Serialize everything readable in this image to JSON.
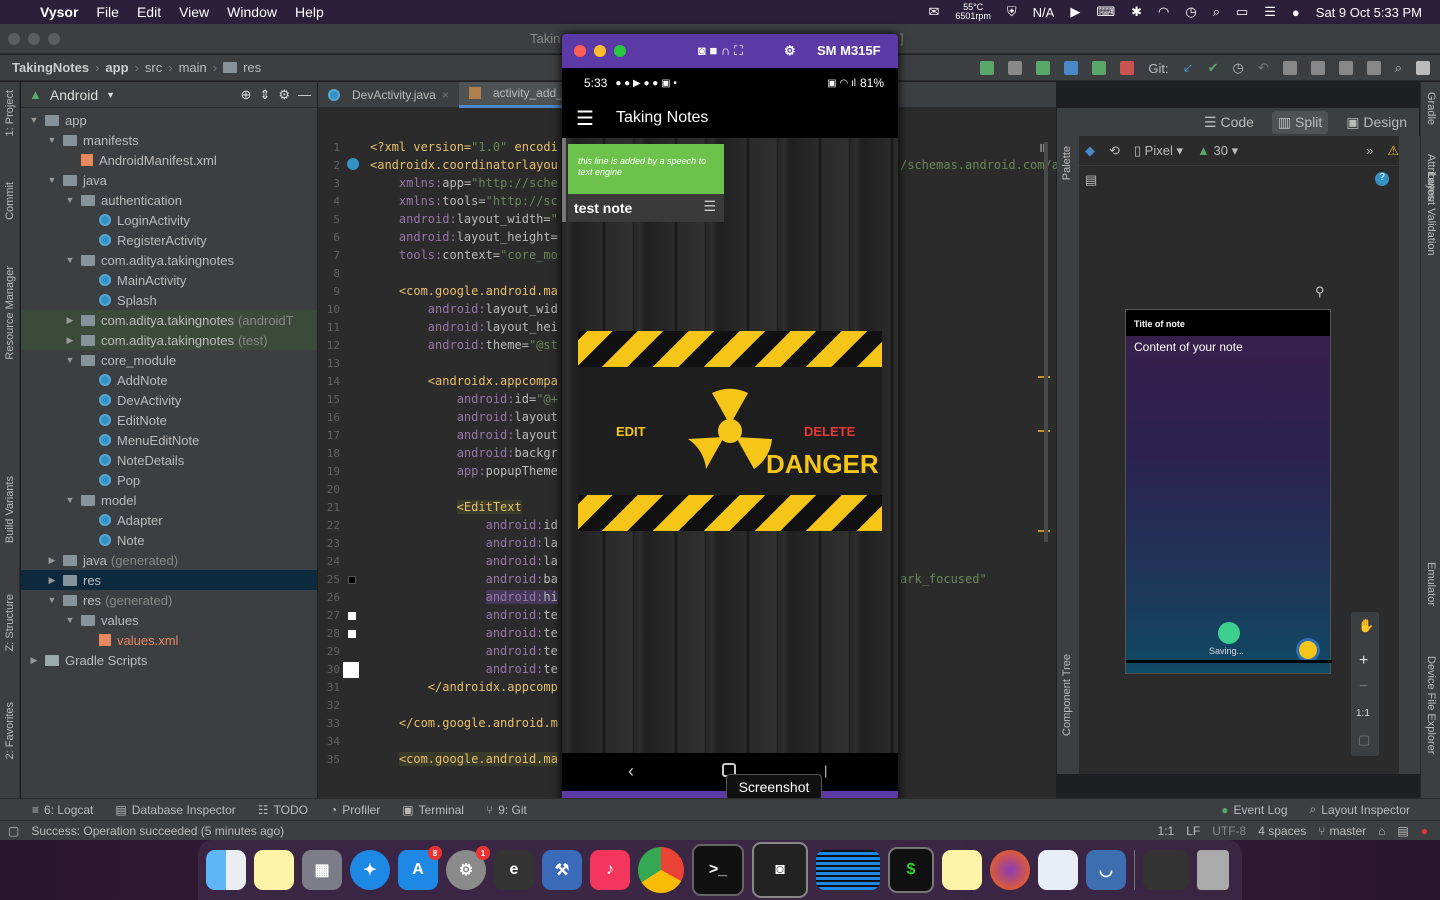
{
  "menubar": {
    "app_name": "Vysor",
    "items": [
      "File",
      "Edit",
      "View",
      "Window",
      "Help"
    ],
    "temp": "55°C",
    "rpm": "6501rpm",
    "na": "N/A",
    "datetime": "Sat 9 Oct  5:33 PM"
  },
  "window": {
    "title": "Takin"
  },
  "breadcrumb": [
    "TakingNotes",
    "app",
    "src",
    "main",
    "res"
  ],
  "toolbar": {
    "git_label": "Git:"
  },
  "left_strip": {
    "project": "1: Project",
    "commit": "Commit",
    "resource": "Resource Manager",
    "build": "Build Variants",
    "structure": "Z: Structure",
    "favorites": "2: Favorites"
  },
  "project_panel": {
    "view_name": "Android",
    "tree": [
      {
        "label": "app",
        "indent": 0,
        "arrow": "▼",
        "icon": "folder"
      },
      {
        "label": "manifests",
        "indent": 1,
        "arrow": "▼",
        "icon": "folder"
      },
      {
        "label": "AndroidManifest.xml",
        "indent": 2,
        "arrow": "",
        "icon": "xml"
      },
      {
        "label": "java",
        "indent": 1,
        "arrow": "▼",
        "icon": "folder"
      },
      {
        "label": "authentication",
        "indent": 2,
        "arrow": "▼",
        "icon": "folder"
      },
      {
        "label": "LoginActivity",
        "indent": 3,
        "arrow": "",
        "icon": "class"
      },
      {
        "label": "RegisterActivity",
        "indent": 3,
        "arrow": "",
        "icon": "class"
      },
      {
        "label": "com.aditya.takingnotes",
        "indent": 2,
        "arrow": "▼",
        "icon": "folder"
      },
      {
        "label": "MainActivity",
        "indent": 3,
        "arrow": "",
        "icon": "class"
      },
      {
        "label": "Splash",
        "indent": 3,
        "arrow": "",
        "icon": "class"
      },
      {
        "label": "com.aditya.takingnotes",
        "suffix": "(androidT",
        "indent": 2,
        "arrow": "▶",
        "icon": "folder",
        "hl": true
      },
      {
        "label": "com.aditya.takingnotes",
        "suffix": "(test)",
        "indent": 2,
        "arrow": "▶",
        "icon": "folder",
        "hl": true
      },
      {
        "label": "core_module",
        "indent": 2,
        "arrow": "▼",
        "icon": "folder"
      },
      {
        "label": "AddNote",
        "indent": 3,
        "arrow": "",
        "icon": "class"
      },
      {
        "label": "DevActivity",
        "indent": 3,
        "arrow": "",
        "icon": "class"
      },
      {
        "label": "EditNote",
        "indent": 3,
        "arrow": "",
        "icon": "class"
      },
      {
        "label": "MenuEditNote",
        "indent": 3,
        "arrow": "",
        "icon": "class"
      },
      {
        "label": "NoteDetails",
        "indent": 3,
        "arrow": "",
        "icon": "class"
      },
      {
        "label": "Pop",
        "indent": 3,
        "arrow": "",
        "icon": "class"
      },
      {
        "label": "model",
        "indent": 2,
        "arrow": "▼",
        "icon": "folder"
      },
      {
        "label": "Adapter",
        "indent": 3,
        "arrow": "",
        "icon": "class"
      },
      {
        "label": "Note",
        "indent": 3,
        "arrow": "",
        "icon": "class"
      },
      {
        "label": "java",
        "suffix": "(generated)",
        "indent": 1,
        "arrow": "▶",
        "icon": "folder"
      },
      {
        "label": "res",
        "indent": 1,
        "arrow": "▶",
        "icon": "folder",
        "sel": true
      },
      {
        "label": "res",
        "suffix": "(generated)",
        "indent": 1,
        "arrow": "▼",
        "icon": "folder"
      },
      {
        "label": "values",
        "indent": 2,
        "arrow": "▼",
        "icon": "folder"
      },
      {
        "label": "values.xml",
        "indent": 3,
        "arrow": "",
        "icon": "xml",
        "orange": true
      },
      {
        "label": "Gradle Scripts",
        "indent": 0,
        "arrow": "▶",
        "icon": "gradle"
      }
    ]
  },
  "editor": {
    "tabs": [
      {
        "label": "DevActivity.java",
        "active": false
      },
      {
        "label": "activity_add_",
        "active": true
      }
    ],
    "lines": [
      {
        "n": "1",
        "html": "<span class='ct'>&lt;?xml version=</span><span class='cv'>\"1.0\"</span><span class='ct'> encodi</span>"
      },
      {
        "n": "2",
        "html": "<span class='ct'>&lt;androidx.coordinatorlayou</span>"
      },
      {
        "n": "3",
        "html": "&nbsp;&nbsp;&nbsp;&nbsp;<span class='cp'>xmlns:</span><span class='ca'>app=</span><span class='cv'>\"http://sche</span>"
      },
      {
        "n": "4",
        "html": "&nbsp;&nbsp;&nbsp;&nbsp;<span class='cp'>xmlns:</span><span class='ca'>tools=</span><span class='cv'>\"http://sc</span>"
      },
      {
        "n": "5",
        "html": "&nbsp;&nbsp;&nbsp;&nbsp;<span class='cp'>android:</span><span class='ca'>layout_width=</span><span class='cv'>\"</span>"
      },
      {
        "n": "6",
        "html": "&nbsp;&nbsp;&nbsp;&nbsp;<span class='cp'>android:</span><span class='ca'>layout_height=</span>"
      },
      {
        "n": "7",
        "html": "&nbsp;&nbsp;&nbsp;&nbsp;<span class='cp'>tools:</span><span class='ca'>context=</span><span class='cv'>\"core_mo</span>"
      },
      {
        "n": "8",
        "html": ""
      },
      {
        "n": "9",
        "html": "&nbsp;&nbsp;&nbsp;&nbsp;<span class='ct'>&lt;com.google.android.ma</span>"
      },
      {
        "n": "10",
        "html": "&nbsp;&nbsp;&nbsp;&nbsp;&nbsp;&nbsp;&nbsp;&nbsp;<span class='cp'>android:</span><span class='ca'>layout_wid</span>"
      },
      {
        "n": "11",
        "html": "&nbsp;&nbsp;&nbsp;&nbsp;&nbsp;&nbsp;&nbsp;&nbsp;<span class='cp'>android:</span><span class='ca'>layout_hei</span>"
      },
      {
        "n": "12",
        "html": "&nbsp;&nbsp;&nbsp;&nbsp;&nbsp;&nbsp;&nbsp;&nbsp;<span class='cp'>android:</span><span class='ca'>theme=</span><span class='cv'>\"@st</span>"
      },
      {
        "n": "13",
        "html": ""
      },
      {
        "n": "14",
        "html": "&nbsp;&nbsp;&nbsp;&nbsp;&nbsp;&nbsp;&nbsp;&nbsp;<span class='ct'>&lt;androidx.appcompa</span>"
      },
      {
        "n": "15",
        "html": "&nbsp;&nbsp;&nbsp;&nbsp;&nbsp;&nbsp;&nbsp;&nbsp;&nbsp;&nbsp;&nbsp;&nbsp;<span class='cp'>android:</span><span class='ca'>id=</span><span class='cv'>\"@+</span>"
      },
      {
        "n": "16",
        "html": "&nbsp;&nbsp;&nbsp;&nbsp;&nbsp;&nbsp;&nbsp;&nbsp;&nbsp;&nbsp;&nbsp;&nbsp;<span class='cp'>android:</span><span class='ca'>layout</span>"
      },
      {
        "n": "17",
        "html": "&nbsp;&nbsp;&nbsp;&nbsp;&nbsp;&nbsp;&nbsp;&nbsp;&nbsp;&nbsp;&nbsp;&nbsp;<span class='cp'>android:</span><span class='ca'>layout</span>"
      },
      {
        "n": "18",
        "html": "&nbsp;&nbsp;&nbsp;&nbsp;&nbsp;&nbsp;&nbsp;&nbsp;&nbsp;&nbsp;&nbsp;&nbsp;<span class='cp'>android:</span><span class='ca'>backgr</span>"
      },
      {
        "n": "19",
        "html": "&nbsp;&nbsp;&nbsp;&nbsp;&nbsp;&nbsp;&nbsp;&nbsp;&nbsp;&nbsp;&nbsp;&nbsp;<span class='cp'>app:</span><span class='ca'>popupTheme</span>"
      },
      {
        "n": "20",
        "html": ""
      },
      {
        "n": "21",
        "html": "&nbsp;&nbsp;&nbsp;&nbsp;&nbsp;&nbsp;&nbsp;&nbsp;&nbsp;&nbsp;&nbsp;&nbsp;<span class='ct' style='background:#3b3b2a'>&lt;EditText</span>"
      },
      {
        "n": "22",
        "html": "&nbsp;&nbsp;&nbsp;&nbsp;&nbsp;&nbsp;&nbsp;&nbsp;&nbsp;&nbsp;&nbsp;&nbsp;&nbsp;&nbsp;&nbsp;&nbsp;<span class='cp'>android:</span><span class='ca'>id</span>"
      },
      {
        "n": "23",
        "html": "&nbsp;&nbsp;&nbsp;&nbsp;&nbsp;&nbsp;&nbsp;&nbsp;&nbsp;&nbsp;&nbsp;&nbsp;&nbsp;&nbsp;&nbsp;&nbsp;<span class='cp'>android:</span><span class='ca'>la</span>"
      },
      {
        "n": "24",
        "html": "&nbsp;&nbsp;&nbsp;&nbsp;&nbsp;&nbsp;&nbsp;&nbsp;&nbsp;&nbsp;&nbsp;&nbsp;&nbsp;&nbsp;&nbsp;&nbsp;<span class='cp'>android:</span><span class='ca'>la</span>"
      },
      {
        "n": "25",
        "html": "&nbsp;&nbsp;&nbsp;&nbsp;&nbsp;&nbsp;&nbsp;&nbsp;&nbsp;&nbsp;&nbsp;&nbsp;&nbsp;&nbsp;&nbsp;&nbsp;<span class='cp'>android:</span><span class='ca'>ba</span>"
      },
      {
        "n": "26",
        "html": "&nbsp;&nbsp;&nbsp;&nbsp;&nbsp;&nbsp;&nbsp;&nbsp;&nbsp;&nbsp;&nbsp;&nbsp;&nbsp;&nbsp;&nbsp;&nbsp;<span class='cp' style='background:#44395a'>android:</span><span class='ca' style='background:#44395a'>hi</span>"
      },
      {
        "n": "27",
        "html": "&nbsp;&nbsp;&nbsp;&nbsp;&nbsp;&nbsp;&nbsp;&nbsp;&nbsp;&nbsp;&nbsp;&nbsp;&nbsp;&nbsp;&nbsp;&nbsp;<span class='cp'>android:</span><span class='ca'>te</span>"
      },
      {
        "n": "28",
        "html": "&nbsp;&nbsp;&nbsp;&nbsp;&nbsp;&nbsp;&nbsp;&nbsp;&nbsp;&nbsp;&nbsp;&nbsp;&nbsp;&nbsp;&nbsp;&nbsp;<span class='cp'>android:</span><span class='ca'>te</span>"
      },
      {
        "n": "29",
        "html": "&nbsp;&nbsp;&nbsp;&nbsp;&nbsp;&nbsp;&nbsp;&nbsp;&nbsp;&nbsp;&nbsp;&nbsp;&nbsp;&nbsp;&nbsp;&nbsp;<span class='cp'>android:</span><span class='ca'>te</span>"
      },
      {
        "n": "30",
        "html": "&nbsp;&nbsp;&nbsp;&nbsp;&nbsp;&nbsp;&nbsp;&nbsp;&nbsp;&nbsp;&nbsp;&nbsp;&nbsp;&nbsp;&nbsp;&nbsp;<span class='cp'>android:</span><span class='ca'>te</span>"
      },
      {
        "n": "31",
        "html": "&nbsp;&nbsp;&nbsp;&nbsp;&nbsp;&nbsp;&nbsp;&nbsp;<span class='ct'>&lt;/androidx.appcomp</span>"
      },
      {
        "n": "32",
        "html": ""
      },
      {
        "n": "33",
        "html": "&nbsp;&nbsp;&nbsp;&nbsp;<span class='ct'>&lt;/com.google.android.m</span>"
      },
      {
        "n": "34",
        "html": ""
      },
      {
        "n": "35",
        "html": "&nbsp;&nbsp;&nbsp;&nbsp;<span class='ct' style='background:#3b3b2a'>&lt;com.google.android.ma</span>"
      }
    ],
    "overflow_text_1": "/schemas.android.com/a",
    "overflow_text_2": "ark_focused\""
  },
  "phone": {
    "device_name": "SM M315F",
    "time": "5:33",
    "battery": "81%",
    "app_title": "Taking Notes",
    "note_speech": "this line is added by a speech to text engine",
    "note_title": "test note",
    "danger_edit": "EDIT",
    "danger_delete": "DELETE",
    "danger_word": "DANGER",
    "tooltip": "Screenshot"
  },
  "design": {
    "modes": [
      "Code",
      "Split",
      "Design"
    ],
    "device": "Pixel",
    "api": "30",
    "palette": "Palette",
    "component_tree": "Component Tree",
    "preview_title": "Title of note",
    "preview_content": "Content of your note",
    "preview_saving": "Saving...",
    "zoom_label": "1:1"
  },
  "right_strip": {
    "gradle": "Gradle",
    "attributes": "Attributes",
    "layout_validation": "Layout Validation",
    "emulator": "Emulator",
    "device_file_explorer": "Device File Explorer"
  },
  "bottom_tools": [
    {
      "label": "6: Logcat"
    },
    {
      "label": "Database Inspector"
    },
    {
      "label": "TODO"
    },
    {
      "label": "Profiler"
    },
    {
      "label": "Terminal"
    },
    {
      "label": "9: Git"
    }
  ],
  "bottom_right_tools": [
    {
      "label": "Event Log"
    },
    {
      "label": "Layout Inspector"
    }
  ],
  "statusbar": {
    "message": "Success: Operation succeeded (5 minutes ago)",
    "position": "1:1",
    "lf": "LF",
    "encoding": "UTF-8",
    "indent": "4 spaces",
    "branch": "master"
  },
  "dock": {
    "appstore_badge": "8",
    "prefs_badge": "1"
  }
}
